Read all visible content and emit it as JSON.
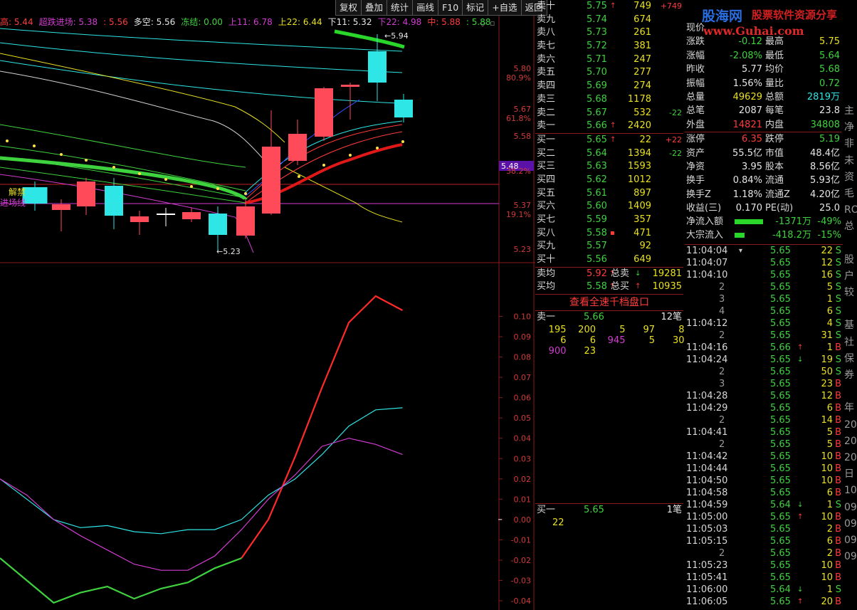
{
  "toolbar": {
    "buttons": [
      "复权",
      "叠加",
      "统计",
      "画线",
      "F10",
      "标记",
      "+自选",
      "返回"
    ]
  },
  "indicators": [
    {
      "text": "高: 5.44",
      "color": "#ff3b3b"
    },
    {
      "text": "超跌进场: 5.38",
      "color": "#d23cd2"
    },
    {
      "text": ": 5.56",
      "color": "#ff3b3b"
    },
    {
      "text": "多空: 5.56",
      "color": "#e6e6e6"
    },
    {
      "text": "冻结: 0.00",
      "color": "#3fd23f"
    },
    {
      "text": "上11: 6.78",
      "color": "#d23cd2"
    },
    {
      "text": "上22: 6.44",
      "color": "#e8e020"
    },
    {
      "text": "下11: 5.32",
      "color": "#e6e6e6"
    },
    {
      "text": "下22: 4.98",
      "color": "#d23cd2"
    },
    {
      "text": "中: 5.88",
      "color": "#ff3b3b"
    },
    {
      "text": ": 5.88",
      "color": "#3fd23f"
    }
  ],
  "main_chart": {
    "price_labels": [
      "5.80",
      "80.9%",
      "5.67",
      "61.8%",
      "5.58",
      "38.2%",
      "5.37",
      "19.1%",
      "5.23"
    ],
    "current_price_tag": "5.48",
    "high_marker": "5.94",
    "low_marker": "5.23",
    "overlay_labels": [
      "解禁",
      "进场线"
    ]
  },
  "chart_data": {
    "type": "line",
    "panel": "indicator",
    "ylim": [
      -0.04,
      0.11
    ],
    "yticks": [
      "0.10",
      "0.09",
      "0.08",
      "0.07",
      "0.06",
      "0.05",
      "0.04",
      "0.03",
      "0.02",
      "0.01",
      "0.00",
      "-0.01",
      "-0.02",
      "-0.03",
      "-0.04"
    ],
    "x": [
      0,
      1,
      2,
      3,
      4,
      5,
      6,
      7,
      8,
      9,
      10,
      11,
      12,
      13,
      14,
      15
    ],
    "series": [
      {
        "color": "#ff2a2a",
        "values": [
          null,
          null,
          null,
          null,
          null,
          null,
          null,
          null,
          null,
          -0.019,
          0.0,
          0.031,
          0.065,
          0.097,
          0.11,
          0.103
        ]
      },
      {
        "color": "#2ee6e6",
        "values": [
          0.02,
          0.01,
          0.0,
          -0.004,
          -0.003,
          -0.006,
          -0.007,
          -0.005,
          -0.005,
          0.0,
          0.012,
          0.02,
          0.032,
          0.046,
          0.054,
          0.055
        ]
      },
      {
        "color": "#d23cd2",
        "values": [
          0.02,
          0.012,
          0.0,
          -0.008,
          -0.015,
          -0.022,
          -0.025,
          -0.025,
          -0.018,
          -0.005,
          0.01,
          0.022,
          0.036,
          0.04,
          0.037,
          0.032
        ]
      },
      {
        "color": "#3fd23f",
        "values": [
          -0.019,
          -0.03,
          -0.041,
          -0.036,
          -0.033,
          -0.039,
          -0.034,
          -0.031,
          -0.024,
          -0.019,
          null,
          null,
          null,
          null,
          null,
          null
        ]
      }
    ]
  },
  "order_book": {
    "asks": [
      {
        "label": "卖十",
        "price": "5.75",
        "arrow": "↑",
        "vol": "749",
        "chg": "+749"
      },
      {
        "label": "卖九",
        "price": "5.74",
        "arrow": "",
        "vol": "674",
        "chg": ""
      },
      {
        "label": "卖八",
        "price": "5.73",
        "arrow": "",
        "vol": "261",
        "chg": ""
      },
      {
        "label": "卖七",
        "price": "5.72",
        "arrow": "",
        "vol": "381",
        "chg": ""
      },
      {
        "label": "卖六",
        "price": "5.71",
        "arrow": "",
        "vol": "247",
        "chg": ""
      },
      {
        "label": "卖五",
        "price": "5.70",
        "arrow": "",
        "vol": "277",
        "chg": ""
      },
      {
        "label": "卖四",
        "price": "5.69",
        "arrow": "",
        "vol": "274",
        "chg": ""
      },
      {
        "label": "卖三",
        "price": "5.68",
        "arrow": "",
        "vol": "1178",
        "chg": ""
      },
      {
        "label": "卖二",
        "price": "5.67",
        "arrow": "",
        "vol": "532",
        "chg": "-22"
      },
      {
        "label": "卖一",
        "price": "5.66",
        "arrow": "↑",
        "vol": "2420",
        "chg": ""
      }
    ],
    "bids": [
      {
        "label": "买一",
        "price": "5.65",
        "arrow": "↑",
        "vol": "22",
        "chg": "+22"
      },
      {
        "label": "买二",
        "price": "5.64",
        "arrow": "",
        "vol": "1394",
        "chg": "-22"
      },
      {
        "label": "买三",
        "price": "5.63",
        "arrow": "",
        "vol": "1593",
        "chg": ""
      },
      {
        "label": "买四",
        "price": "5.62",
        "arrow": "",
        "vol": "1012",
        "chg": ""
      },
      {
        "label": "买五",
        "price": "5.61",
        "arrow": "",
        "vol": "897",
        "chg": ""
      },
      {
        "label": "买六",
        "price": "5.60",
        "arrow": "",
        "vol": "1409",
        "chg": ""
      },
      {
        "label": "买七",
        "price": "5.59",
        "arrow": "",
        "vol": "357",
        "chg": ""
      },
      {
        "label": "买八",
        "price": "5.58",
        "arrow": "▪",
        "vol": "471",
        "chg": ""
      },
      {
        "label": "买九",
        "price": "5.57",
        "arrow": "",
        "vol": "92",
        "chg": ""
      },
      {
        "label": "买十",
        "price": "5.56",
        "arrow": "",
        "vol": "649",
        "chg": ""
      }
    ],
    "avg_sell_label": "卖均",
    "avg_sell_price": "5.92",
    "total_sell_label": "总卖",
    "total_sell": "19281",
    "avg_buy_label": "买均",
    "avg_buy_price": "5.58",
    "total_buy_label": "总买",
    "total_buy": "10935",
    "full_depth_button": "查看全速千档盘口",
    "queue_sell": {
      "label": "卖一",
      "price": "5.66",
      "count": "12笔",
      "orders": [
        [
          "195",
          "200",
          "5",
          "97",
          "8"
        ],
        [
          "6",
          "6",
          "945",
          "5",
          "30"
        ],
        [
          "900",
          "23"
        ]
      ]
    },
    "queue_buy": {
      "label": "买一",
      "price": "5.65",
      "count": "1笔",
      "orders": [
        "22"
      ]
    }
  },
  "watermark": {
    "brand": "股海网",
    "slogan": "股票软件资源分享",
    "url": "www.Guhai.com"
  },
  "quote": {
    "rows": [
      {
        "l1": "现价",
        "v1": "",
        "c1": "#3fd23f",
        "l2": "",
        "v2": "",
        "c2": "#e6e6e6"
      },
      {
        "l1": "涨跌",
        "v1": "-0.12",
        "c1": "#3fd23f",
        "l2": "最高",
        "v2": "5.75",
        "c2": "#e8e020"
      },
      {
        "l1": "涨幅",
        "v1": "-2.08%",
        "c1": "#3fd23f",
        "l2": "最低",
        "v2": "5.64",
        "c2": "#3fd23f"
      },
      {
        "l1": "昨收",
        "v1": "5.77",
        "c1": "#e6e6e6",
        "l2": "均价",
        "v2": "5.68",
        "c2": "#3fd23f"
      },
      {
        "l1": "振幅",
        "v1": "1.56%",
        "c1": "#e6e6e6",
        "l2": "量比",
        "v2": "0.72",
        "c2": "#3fd23f"
      },
      {
        "l1": "总量",
        "v1": "49629",
        "c1": "#e8e020",
        "l2": "总额",
        "v2": "2819万",
        "c2": "#2ee6e6"
      },
      {
        "l1": "总笔",
        "v1": "2087",
        "c1": "#e6e6e6",
        "l2": "每笔",
        "v2": "23.8",
        "c2": "#e6e6e6"
      },
      {
        "l1": "外盘",
        "v1": "14821",
        "c1": "#ff3b3b",
        "l2": "内盘",
        "v2": "34808",
        "c2": "#3fd23f"
      },
      {
        "l1": "涨停",
        "v1": "6.35",
        "c1": "#ff3b3b",
        "l2": "跌停",
        "v2": "5.19",
        "c2": "#3fd23f"
      },
      {
        "l1": "资产",
        "v1": "55.5亿",
        "c1": "#e6e6e6",
        "l2": "市值",
        "v2": "48.4亿",
        "c2": "#e6e6e6"
      },
      {
        "l1": "净资",
        "v1": "3.95",
        "c1": "#e6e6e6",
        "l2": "股本",
        "v2": "8.56亿",
        "c2": "#e6e6e6"
      },
      {
        "l1": "换手",
        "v1": "0.84%",
        "c1": "#e6e6e6",
        "l2": "流通",
        "v2": "5.93亿",
        "c2": "#e6e6e6"
      },
      {
        "l1": "换手Z",
        "v1": "1.18%",
        "c1": "#e6e6e6",
        "l2": "流通Z",
        "v2": "4.20亿",
        "c2": "#e6e6e6"
      },
      {
        "l1": "收益(三)",
        "v1": "0.170",
        "c1": "#e6e6e6",
        "l2": "PE(动)",
        "v2": "25.0",
        "c2": "#e6e6e6"
      }
    ],
    "net_inflow_label": "净流入额",
    "net_inflow_value": "-1371万",
    "net_inflow_pct": "-49%",
    "net_inflow_fill": 0.49,
    "block_inflow_label": "大宗流入",
    "block_inflow_value": "-418.2万",
    "block_inflow_pct": "-15%",
    "block_inflow_fill": 0.15
  },
  "ticks": [
    {
      "t": "11:04:04",
      "p": "5.65",
      "a": "",
      "v": "22",
      "s": "S"
    },
    {
      "t": "11:04:07",
      "p": "5.65",
      "a": "",
      "v": "12",
      "s": "S"
    },
    {
      "t": "11:04:10",
      "p": "5.65",
      "a": "",
      "v": "16",
      "s": "S"
    },
    {
      "t": "2",
      "p": "5.65",
      "a": "",
      "v": "5",
      "s": "S"
    },
    {
      "t": "3",
      "p": "5.65",
      "a": "",
      "v": "1",
      "s": "S"
    },
    {
      "t": "4",
      "p": "5.65",
      "a": "",
      "v": "6",
      "s": "S"
    },
    {
      "t": "11:04:12",
      "p": "5.65",
      "a": "",
      "v": "4",
      "s": "S"
    },
    {
      "t": "2",
      "p": "5.65",
      "a": "",
      "v": "31",
      "s": "S"
    },
    {
      "t": "11:04:16",
      "p": "5.66",
      "a": "↑",
      "v": "1",
      "s": "B"
    },
    {
      "t": "11:04:24",
      "p": "5.65",
      "a": "↓",
      "v": "19",
      "s": "S"
    },
    {
      "t": "2",
      "p": "5.65",
      "a": "",
      "v": "50",
      "s": "S"
    },
    {
      "t": "3",
      "p": "5.65",
      "a": "",
      "v": "23",
      "s": "B"
    },
    {
      "t": "11:04:28",
      "p": "5.65",
      "a": "",
      "v": "12",
      "s": "B"
    },
    {
      "t": "11:04:29",
      "p": "5.65",
      "a": "",
      "v": "6",
      "s": "B"
    },
    {
      "t": "2",
      "p": "5.65",
      "a": "",
      "v": "14",
      "s": "B"
    },
    {
      "t": "11:04:41",
      "p": "5.65",
      "a": "",
      "v": "5",
      "s": "B"
    },
    {
      "t": "2",
      "p": "5.65",
      "a": "",
      "v": "5",
      "s": "B"
    },
    {
      "t": "11:04:42",
      "p": "5.65",
      "a": "",
      "v": "10",
      "s": "B"
    },
    {
      "t": "11:04:44",
      "p": "5.65",
      "a": "",
      "v": "10",
      "s": "B"
    },
    {
      "t": "11:04:50",
      "p": "5.65",
      "a": "",
      "v": "10",
      "s": "B"
    },
    {
      "t": "11:04:58",
      "p": "5.65",
      "a": "",
      "v": "6",
      "s": "B"
    },
    {
      "t": "11:04:59",
      "p": "5.64",
      "a": "↓",
      "v": "1",
      "s": "S"
    },
    {
      "t": "11:05:00",
      "p": "5.65",
      "a": "↑",
      "v": "10",
      "s": "B"
    },
    {
      "t": "11:05:03",
      "p": "5.65",
      "a": "",
      "v": "2",
      "s": "B"
    },
    {
      "t": "11:05:15",
      "p": "5.65",
      "a": "",
      "v": "6",
      "s": "B"
    },
    {
      "t": "2",
      "p": "5.65",
      "a": "",
      "v": "2",
      "s": "B"
    },
    {
      "t": "11:05:23",
      "p": "5.65",
      "a": "",
      "v": "10",
      "s": "B"
    },
    {
      "t": "11:05:41",
      "p": "5.65",
      "a": "",
      "v": "10",
      "s": "B"
    },
    {
      "t": "11:06:00",
      "p": "5.64",
      "a": "↓",
      "v": "1",
      "s": "S"
    },
    {
      "t": "11:06:05",
      "p": "5.65",
      "a": "↑",
      "v": "20",
      "s": "B"
    }
  ],
  "right_edge": [
    "主",
    "净",
    "非",
    "未",
    "资",
    "毛",
    "RO",
    "总",
    "",
    "股",
    "户",
    "较",
    "",
    "基",
    "社",
    "保",
    "券",
    "",
    "年",
    "20",
    "20",
    "20",
    "日",
    "10",
    "09",
    "09",
    "09",
    "09"
  ]
}
